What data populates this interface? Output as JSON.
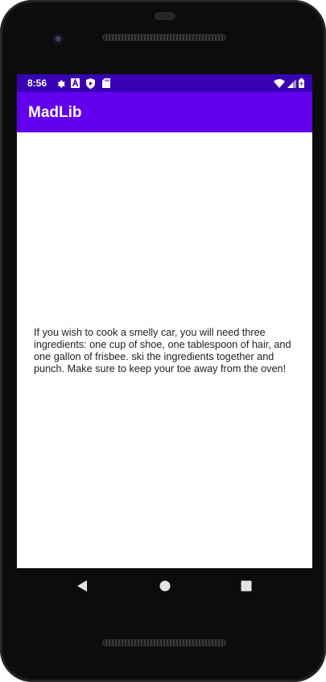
{
  "status_bar": {
    "time": "8:56",
    "icons": [
      "settings-gear-icon",
      "font-a-icon",
      "shield-play-icon",
      "sd-card-icon",
      "wifi-icon",
      "cell-signal-icon",
      "battery-charging-icon"
    ],
    "color": "#3700b3"
  },
  "app_bar": {
    "title": "MadLib",
    "color": "#6200ee"
  },
  "main": {
    "story": "If you wish to cook a smelly car, you will need three ingredients: one cup of shoe, one tablespoon of hair, and one gallon of frisbee.  ski the ingredients together and punch.  Make sure to keep your toe away from the oven!"
  },
  "navigation": {
    "buttons": [
      "back-icon",
      "home-icon",
      "recents-icon"
    ]
  }
}
